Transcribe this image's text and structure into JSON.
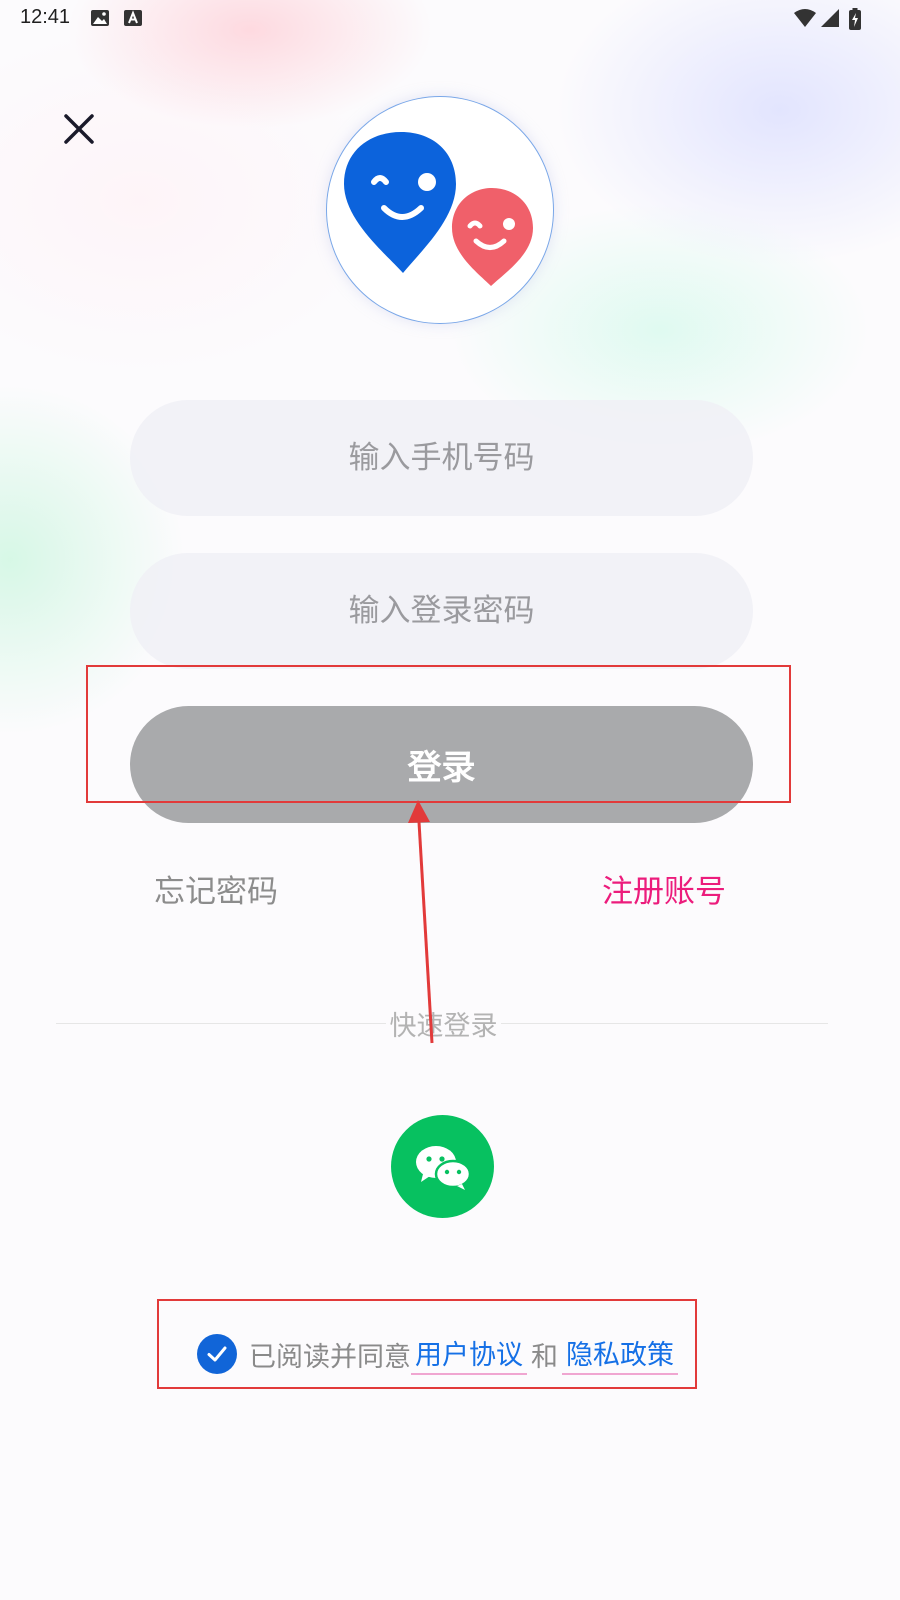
{
  "status_bar": {
    "time": "12:41",
    "left_icons": [
      "image-icon",
      "font-a-icon"
    ],
    "right_icons": [
      "wifi-icon",
      "signal-icon",
      "battery-charging-icon"
    ]
  },
  "header": {
    "close_icon": "close-icon",
    "logo_icon": "smiling-map-pins-logo",
    "logo_colors": {
      "blue": "#0c63dc",
      "red": "#f0606a"
    }
  },
  "form": {
    "phone_placeholder": "输入手机号码",
    "password_placeholder": "输入登录密码",
    "login_label": "登录",
    "forgot_label": "忘记密码",
    "register_label": "注册账号"
  },
  "quick_login": {
    "label": "快速登录",
    "wechat_icon": "wechat-icon",
    "wechat_color": "#07c160"
  },
  "agreement": {
    "checked": true,
    "prefix": "已阅读并同意",
    "user_agreement": "用户协议",
    "and": "和",
    "privacy_policy": "隐私政策"
  },
  "colors": {
    "accent_blue": "#1165d8",
    "register_pink": "#ec1c7c",
    "annotation_red": "#e23a3a",
    "button_disabled": "#a9aaac"
  }
}
